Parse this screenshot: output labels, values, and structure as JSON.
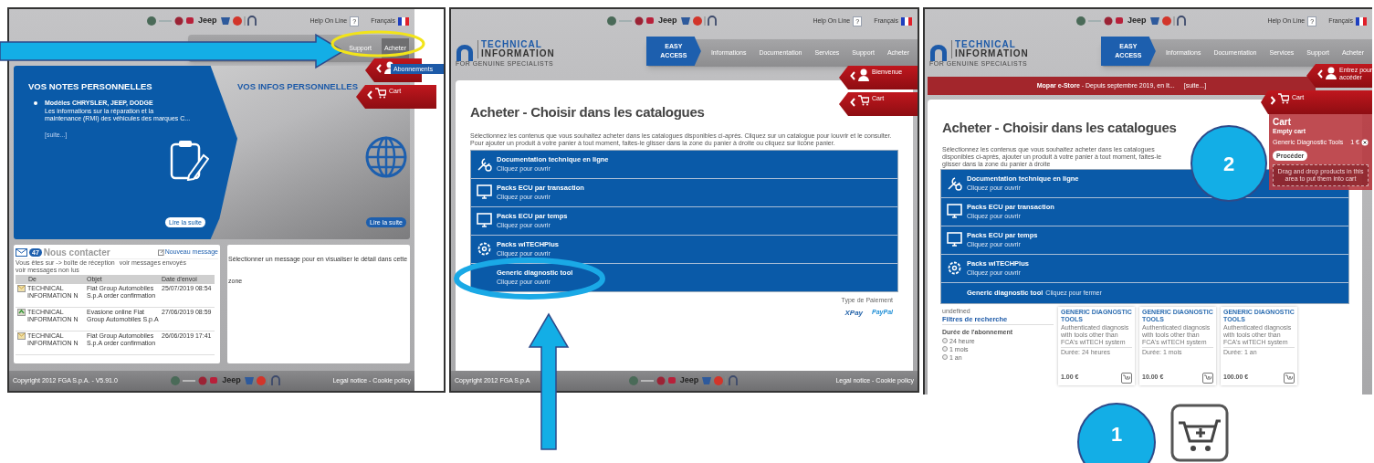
{
  "screens": [
    {
      "kind": "home",
      "header": {
        "wordmark": "Jeep",
        "help": "Help On Line",
        "help_badge": "?",
        "language": "Français"
      },
      "nav": [
        {
          "label": "Support",
          "kind": "tab",
          "selected": false
        },
        {
          "label": "Acheter",
          "kind": "tab",
          "selected": true
        }
      ],
      "dropdown": [
        "Abonnements"
      ],
      "side_tabs": [
        {
          "kind": "user"
        },
        {
          "kind": "cart",
          "label": "Cart"
        }
      ],
      "notes": {
        "title": "VOS NOTES PERSONNELLES",
        "item_title": "Modèles CHRYSLER, JEEP, DODGE",
        "item_text": "Les informations sur la réparation et la maintenance (RMI) des véhicules des marques C...",
        "item_link": "[suite...]",
        "button": "Lire la suite"
      },
      "infos": {
        "title": "VOS INFOS PERSONNELLES",
        "button": "Lire la suite"
      },
      "messages": {
        "count": "47",
        "title": "Nous contacter",
        "new_message": "Nouveau message",
        "location": "Vous êtes sur -> boîte de réception",
        "links": [
          "voir messages envoyés",
          "voir messages non lus"
        ],
        "columns": [
          "De",
          "Objet",
          "Date d'envoi"
        ],
        "rows": [
          {
            "kind": "mail",
            "from": "TECHNICAL INFORMATION N",
            "subject": "Fiat Group Automobiles S.p.A order confirmation",
            "date": "25/07/2019 08:54"
          },
          {
            "kind": "reply",
            "from": "TECHNICAL INFORMATION N",
            "subject": "Evasione online Fiat Group Automobiles S.p.A",
            "date": "27/06/2019 08:59"
          },
          {
            "kind": "mail",
            "from": "TECHNICAL INFORMATION N",
            "subject": "Fiat Group Automobiles S.p.A order confirmation",
            "date": "26/06/2019 17:41"
          }
        ],
        "detail": "Sélectionner un message pour en visualiser le détail dans cette zone"
      },
      "footer": {
        "copyright": "Copyright 2012 FGA S.p.A. - V5.91.0",
        "wordmark": "Jeep",
        "legal": "Legal notice - Cookie policy"
      }
    },
    {
      "kind": "catalogue",
      "header": {
        "wordmark": "Jeep",
        "help": "Help On Line",
        "help_badge": "?",
        "language": "Français"
      },
      "logo": {
        "line1": "TECHNICAL",
        "line2": "INFORMATION",
        "tagline": "FOR GENUINE SPECIALISTS"
      },
      "nav": [
        {
          "label": "EASY ACCESS",
          "kind": "easy",
          "selected": true
        },
        {
          "label": "Informations",
          "kind": "tab",
          "selected": false
        },
        {
          "label": "Documentation",
          "kind": "tab",
          "selected": false
        },
        {
          "label": "Services",
          "kind": "tab",
          "selected": false
        },
        {
          "label": "Support",
          "kind": "tab",
          "selected": false
        },
        {
          "label": "Acheter",
          "kind": "tab",
          "selected": false
        }
      ],
      "side_tabs": [
        {
          "kind": "user",
          "label": "Bienvenue"
        },
        {
          "kind": "cart",
          "label": "Cart"
        }
      ],
      "heading": "Acheter - Choisir dans les catalogues",
      "intro": "Sélectionnez les contenus que vous souhaitez acheter dans les catalogues disponibles ci-après. Cliquez sur un catalogue pour louvrir et le consulter. Pour ajouter un produit à votre panier à tout moment, faites-le glisser dans la zone du panier à droite ou cliquez sur licône panier.",
      "catalogues": [
        {
          "kind": "wrench",
          "title": "Documentation technique en ligne",
          "hint": "Cliquez pour ouvrir",
          "expanded": false
        },
        {
          "kind": "monitor",
          "title": "Packs ECU par transaction",
          "hint": "Cliquez pour ouvrir",
          "expanded": false
        },
        {
          "kind": "monitor",
          "title": "Packs ECU par temps",
          "hint": "Cliquez pour ouvrir",
          "expanded": false
        },
        {
          "kind": "gear",
          "title": "Packs wiTECHPlus",
          "hint": "Cliquez pour ouvrir",
          "expanded": false
        },
        {
          "kind": "plain",
          "title": "Generic diagnostic tool",
          "hint": "Cliquez pour ouvrir",
          "expanded": false
        }
      ],
      "payment": {
        "label": "Type de Paiement",
        "methods": [
          "XPay",
          "PayPal"
        ]
      },
      "footer": {
        "copyright": "Copyright 2012 FGA S.p.A",
        "wordmark": "Jeep",
        "legal": "Legal notice - Cookie policy"
      }
    },
    {
      "kind": "cart",
      "header": {
        "wordmark": "Jeep",
        "help": "Help On Line",
        "help_badge": "?",
        "language": "Français"
      },
      "logo": {
        "line1": "TECHNICAL",
        "line2": "INFORMATION",
        "tagline": "FOR GENUINE SPECIALISTS"
      },
      "nav": [
        {
          "label": "EASY ACCESS",
          "kind": "easy",
          "selected": true
        },
        {
          "label": "Informations",
          "kind": "tab",
          "selected": false
        },
        {
          "label": "Documentation",
          "kind": "tab",
          "selected": false
        },
        {
          "label": "Services",
          "kind": "tab",
          "selected": false
        },
        {
          "label": "Support",
          "kind": "tab",
          "selected": false
        },
        {
          "label": "Acheter",
          "kind": "tab",
          "selected": false
        }
      ],
      "side_tabs": [
        {
          "kind": "user",
          "label": "Entrez pour accéder"
        },
        {
          "kind": "cart",
          "label": "Cart"
        }
      ],
      "banner": {
        "text": "**Mopar e-Store** - Depuis septembre 2019, en It...",
        "link": "[suite...]"
      },
      "heading": "Acheter - Choisir dans les catalogues",
      "intro": "Sélectionnez les contenus que vous souhaitez acheter dans les catalogues disponibles ci-après, ajouter un produit à votre panier à tout moment, faites-le glisser dans la zone du panier à droite",
      "catalogues": [
        {
          "kind": "wrench",
          "title": "Documentation technique en ligne",
          "hint": "Cliquez pour ouvrir",
          "expanded": false
        },
        {
          "kind": "monitor",
          "title": "Packs ECU par transaction",
          "hint": "Cliquez pour ouvrir",
          "expanded": false
        },
        {
          "kind": "monitor",
          "title": "Packs ECU par temps",
          "hint": "Cliquez pour ouvrir",
          "expanded": false
        },
        {
          "kind": "gear",
          "title": "Packs wiTECHPlus",
          "hint": "Cliquez pour ouvrir",
          "expanded": false
        },
        {
          "kind": "plain",
          "title": "Generic diagnostic tool",
          "hint": "Cliquez pour fermer",
          "expanded": true
        }
      ],
      "filters": {
        "note": "undefined",
        "title": "Filtres de recherche",
        "group": "Durée de l'abonnement",
        "options": [
          {
            "label": "24 heure",
            "checked": false
          },
          {
            "label": "1 mois",
            "checked": false
          },
          {
            "label": "1 an",
            "checked": false
          }
        ]
      },
      "products": [
        {
          "title": "GENERIC DIAGNOSTIC TOOLS",
          "description": "Authenticated diagnosis with tools other than FCA's wiTECH system",
          "duration": "Durée: 24 heures",
          "price": "1.00 €"
        },
        {
          "title": "GENERIC DIAGNOSTIC TOOLS",
          "description": "Authenticated diagnosis with tools other than FCA's wiTECH system",
          "duration": "Durée: 1 mois",
          "price": "10.00 €"
        },
        {
          "title": "GENERIC DIAGNOSTIC TOOLS",
          "description": "Authenticated diagnosis with tools other than FCA's wiTECH system",
          "duration": "Durée: 1 an",
          "price": "100.00 €"
        }
      ],
      "cart": {
        "title": "Cart",
        "status": "Empty cart",
        "items": [
          {
            "name": "Generic Diagnostic Tools",
            "price": "1 €"
          }
        ],
        "button": "Procéder",
        "drop_hint": "Drag and drop products in this area to put them into cart"
      }
    }
  ],
  "step_badges": [
    "1",
    "2"
  ]
}
